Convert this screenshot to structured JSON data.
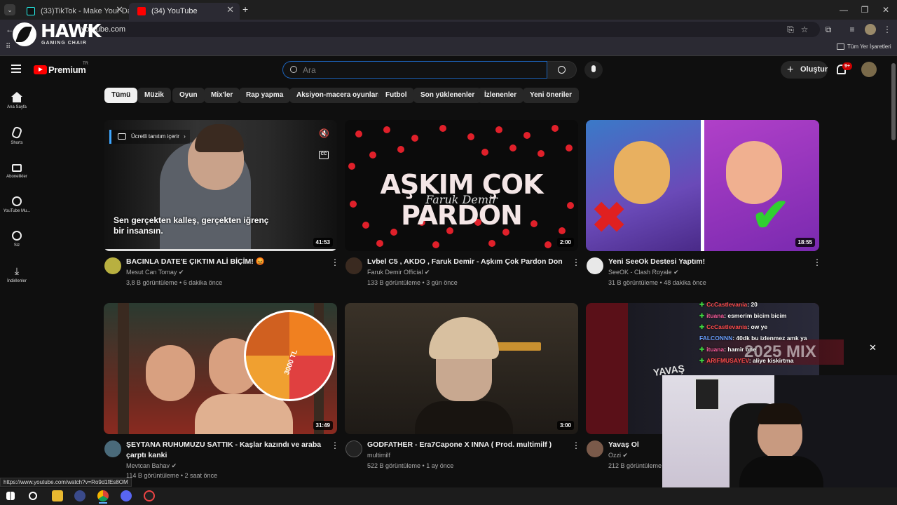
{
  "browser": {
    "tabs": [
      {
        "title": "(33)TikTok - Make Your Day",
        "active": false
      },
      {
        "title": "(34) YouTube",
        "active": true
      }
    ],
    "url": "youtube.com",
    "bookmarks_label": "Tüm Yer İşaretleri",
    "status_url": "https://www.youtube.com/watch?v=Ro9d1fEs8OM"
  },
  "overlay_logo": {
    "brand": "HAWK",
    "tagline": "GAMING CHAIR"
  },
  "header": {
    "premium_label": "Premium",
    "region": "TR",
    "search_placeholder": "Ara",
    "create_label": "Oluştur",
    "notification_count": "9+"
  },
  "sidebar": [
    {
      "label": "Ana Sayfa",
      "icon": "home-icon"
    },
    {
      "label": "Shorts",
      "icon": "shorts-icon"
    },
    {
      "label": "Abonelikler",
      "icon": "subscriptions-icon"
    },
    {
      "label": "YouTube Mu...",
      "icon": "youtube-music-icon"
    },
    {
      "label": "Siz",
      "icon": "you-icon"
    },
    {
      "label": "İndirilenler",
      "icon": "download-icon"
    }
  ],
  "chips": [
    "Tümü",
    "Müzik",
    "Oyun",
    "Mix'ler",
    "Rap yapma",
    "Aksiyon-macera oyunları",
    "Futbol",
    "Son yüklenenler",
    "İzlenenler",
    "Yeni öneriler"
  ],
  "videos": [
    {
      "title": "BACINLA DATE'E ÇIKTIM ALİ BİÇİM! 😡",
      "channel": "Mesut Can Tomay",
      "meta": "3,8 B görüntüleme • 6 dakika önce",
      "duration": "41:53",
      "paid_promo": "Ücretli tanıtım içerir",
      "caption": "Sen gerçekten kalleş, gerçekten iğrenç bir insansın.",
      "thumb_color": "#1d1d1d",
      "progress": 1.0
    },
    {
      "title": "Lvbel C5 , AKDO , Faruk Demir - Aşkım Çok Pardon Don",
      "channel": "Faruk Demir Official",
      "meta": "133 B görüntüleme • 3 gün önce",
      "duration": "2:00",
      "thumb_text": "AŞKIM ÇOK PARDON",
      "thumb_sub": "Faruk Demir",
      "thumb_color": "#0b0b0b"
    },
    {
      "title": "Yeni SeeOk Destesi Yaptım!",
      "channel": "SeeOK - Clash Royale",
      "meta": "31 B görüntüleme • 48 dakika önce",
      "duration": "18:55",
      "thumb_color": "#6a3aa8"
    },
    {
      "title": "ŞEYTANA RUHUMUZU SATTIK - Kaşlar kazındı ve araba çarptı kanki",
      "channel": "Mevtcan Bahav",
      "meta": "114 B görüntüleme • 2 saat önce",
      "duration": "31:49",
      "thumb_text": "3000 TL",
      "thumb_color": "#8a3a2a"
    },
    {
      "title": "GODFATHER - Era7Capone X INNA ( Prod. multimilf )",
      "channel": "multimilf",
      "meta": "522 B görüntüleme • 1 ay önce",
      "duration": "3:00",
      "thumb_color": "#2a2520"
    },
    {
      "title": "Yavaş Ol",
      "channel": "Ozzi",
      "meta": "212 B görüntüleme",
      "duration": "",
      "thumb_text": "YAVAŞ",
      "thumb_color": "#5a1018"
    }
  ],
  "chat": [
    {
      "user": "CcCastlevania",
      "msg": ": 20",
      "color": "#ff4d4d"
    },
    {
      "user": "ituana",
      "msg": ": esmerim bicim bicim",
      "color": "#ff5fa0"
    },
    {
      "user": "CcCastlevania",
      "msg": ": ow ye",
      "color": "#ff4d4d"
    },
    {
      "user": "FALCONNN",
      "msg": ": 40dk bu izlenmez amk ya",
      "color": "#6aa0ff"
    },
    {
      "user": "ituana",
      "msg": ": hamir one",
      "color": "#ff5fa0"
    },
    {
      "user": "ARIFMUSAYEV",
      "msg": ": aliye kiskirtma",
      "color": "#ff4d4d"
    }
  ],
  "mix_banner": "2025 MIX",
  "colors": {
    "accent": "#ff0000",
    "focus": "#1c62b9"
  }
}
